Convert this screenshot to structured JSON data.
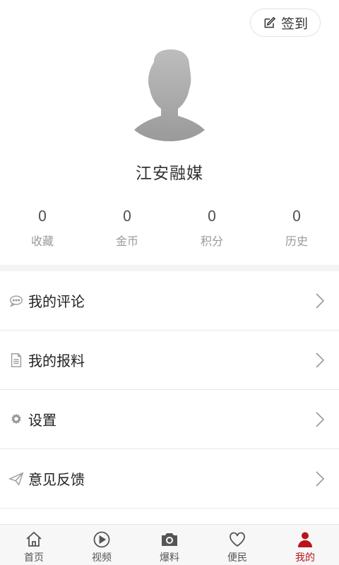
{
  "header": {
    "signin_label": "签到"
  },
  "profile": {
    "username": "江安融媒"
  },
  "stats": [
    {
      "value": "0",
      "label": "收藏"
    },
    {
      "value": "0",
      "label": "金币"
    },
    {
      "value": "0",
      "label": "积分"
    },
    {
      "value": "0",
      "label": "历史"
    }
  ],
  "menu": [
    {
      "label": "我的评论",
      "icon": "comment-icon"
    },
    {
      "label": "我的报料",
      "icon": "document-icon"
    },
    {
      "label": "设置",
      "icon": "gear-icon"
    },
    {
      "label": "意见反馈",
      "icon": "send-icon"
    }
  ],
  "tabs": [
    {
      "label": "首页",
      "icon": "home-icon"
    },
    {
      "label": "视频",
      "icon": "play-icon"
    },
    {
      "label": "爆料",
      "icon": "camera-icon"
    },
    {
      "label": "便民",
      "icon": "heart-icon"
    },
    {
      "label": "我的",
      "icon": "user-icon",
      "active": true
    }
  ],
  "colors": {
    "accent": "#b8161c",
    "stat_label": "#9a9a9a",
    "separator": "#f4f4f4"
  }
}
